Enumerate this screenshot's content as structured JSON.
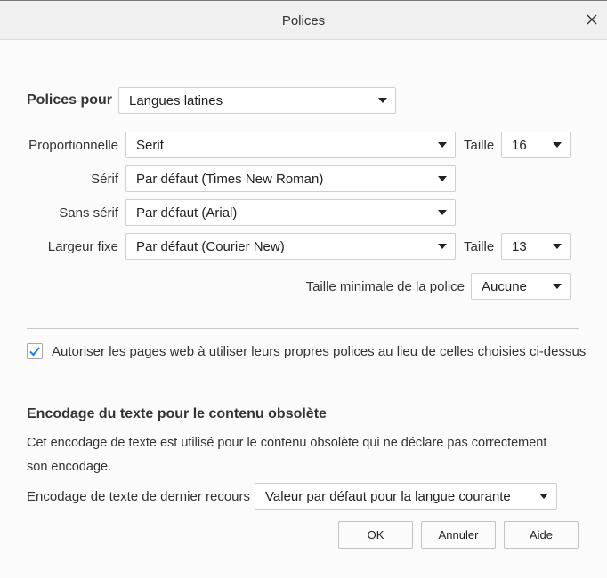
{
  "dialog": {
    "title": "Polices"
  },
  "fonts_for": {
    "label": "Polices pour",
    "value": "Langues latines"
  },
  "rows": {
    "proportional": {
      "label": "Proportionnelle",
      "value": "Serif",
      "size_label": "Taille",
      "size": "16"
    },
    "serif": {
      "label": "Sérif",
      "value": "Par défaut (Times New Roman)"
    },
    "sans": {
      "label": "Sans sérif",
      "value": "Par défaut (Arial)"
    },
    "mono": {
      "label": "Largeur fixe",
      "value": "Par défaut (Courier New)",
      "size_label": "Taille",
      "size": "13"
    },
    "min_size": {
      "label": "Taille minimale de la police",
      "value": "Aucune"
    }
  },
  "allow_fonts": {
    "checked": true,
    "label": "Autoriser les pages web à utiliser leurs propres polices au lieu de celles choisies ci-dessus"
  },
  "encoding": {
    "heading": "Encodage du texte pour le contenu obsolète",
    "description_line1": "Cet encodage de texte est utilisé pour le contenu obsolète qui ne déclare pas correctement",
    "description_line2": "son encodage.",
    "fallback_label": "Encodage de texte de dernier recours",
    "fallback_value": "Valeur par défaut pour la langue courante"
  },
  "buttons": {
    "ok": "OK",
    "cancel": "Annuler",
    "help": "Aide"
  },
  "icons": {
    "close": "close-icon",
    "check": "checkmark-icon",
    "dropdown": "chevron-down-icon"
  },
  "colors": {
    "accent": "#0a84ff",
    "separator": "#c8c8c8"
  }
}
